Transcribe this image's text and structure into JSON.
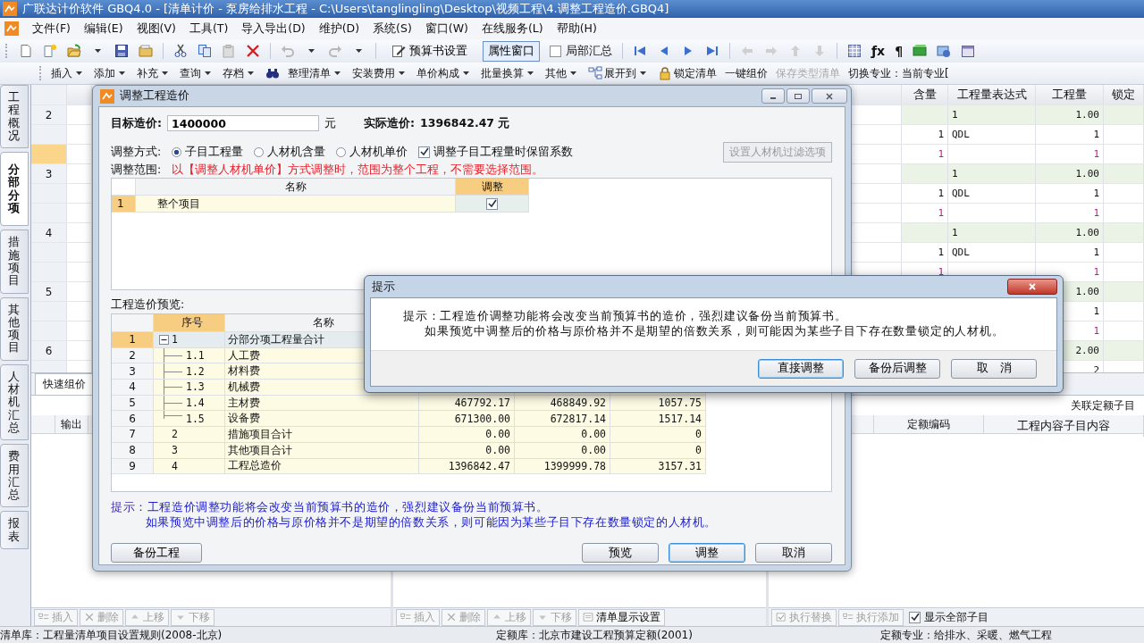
{
  "window": {
    "title": "广联达计价软件 GBQ4.0 - [清单计价 - 泵房给排水工程 - C:\\Users\\tanglingling\\Desktop\\视频工程\\4.调整工程造价.GBQ4]"
  },
  "menu": [
    "文件(F)",
    "编辑(E)",
    "视图(V)",
    "工具(T)",
    "导入导出(D)",
    "维护(D)",
    "系统(S)",
    "窗口(W)",
    "在线服务(L)",
    "帮助(H)"
  ],
  "toolbar": {
    "buttons": [
      {
        "kind": "button",
        "label": "预算书设置",
        "selected": false
      },
      {
        "kind": "button",
        "label": "属性窗口",
        "selected": true
      },
      {
        "kind": "check",
        "label": "局部汇总",
        "checked": false
      }
    ],
    "glyphs": [
      "ƒx",
      "¶"
    ]
  },
  "command_bar": [
    {
      "kind": "text",
      "label": "插入",
      "dropdown": true
    },
    {
      "kind": "text",
      "label": "添加",
      "dropdown": true
    },
    {
      "kind": "text",
      "label": "补充",
      "dropdown": true
    },
    {
      "kind": "text",
      "label": "查询",
      "dropdown": true
    },
    {
      "kind": "text",
      "label": "存档",
      "dropdown": true
    },
    {
      "kind": "search"
    },
    {
      "kind": "text",
      "label": "整理清单",
      "dropdown": true
    },
    {
      "kind": "text",
      "label": "安装费用",
      "dropdown": true
    },
    {
      "kind": "text",
      "label": "单价构成",
      "dropdown": true
    },
    {
      "kind": "text",
      "label": "批量换算",
      "dropdown": true
    },
    {
      "kind": "text",
      "label": "其他",
      "dropdown": true
    },
    {
      "kind": "tree",
      "label": "展开到",
      "dropdown": true
    },
    {
      "kind": "lock",
      "label": "锁定清单",
      "dropdown": false
    },
    {
      "kind": "text",
      "label": "一键组价",
      "dropdown": false
    },
    {
      "kind": "text",
      "label": "保存类型清单",
      "dropdown": false,
      "disabled": true
    },
    {
      "kind": "text",
      "label": "切换专业：当前专业[",
      "dropdown": false
    }
  ],
  "side_tabs": [
    {
      "label": "工程概况",
      "selected": false
    },
    {
      "label": "分部分项",
      "selected": true
    },
    {
      "label": "措施项目",
      "selected": false
    },
    {
      "label": "其他项目",
      "selected": false
    },
    {
      "label": "人材机汇总",
      "selected": false
    },
    {
      "label": "费用汇总",
      "selected": false
    },
    {
      "label": "报表",
      "selected": false
    }
  ],
  "grid": {
    "columns": [
      "含量",
      "工程量表达式",
      "工程量",
      "锁定"
    ],
    "rows": [
      {
        "kind": "list",
        "no": "2",
        "selected": false,
        "cells": [
          "",
          "1",
          "1.00"
        ]
      },
      {
        "kind": "quota",
        "selected": false,
        "cells": [
          "1",
          "QDL",
          "1"
        ]
      },
      {
        "kind": "material",
        "selected": true,
        "cells": [
          "1",
          "",
          "1"
        ]
      },
      {
        "kind": "list",
        "no": "3",
        "selected": false,
        "cells": [
          "",
          "1",
          "1.00"
        ]
      },
      {
        "kind": "quota",
        "selected": false,
        "cells": [
          "1",
          "QDL",
          "1"
        ]
      },
      {
        "kind": "material",
        "selected": false,
        "cells": [
          "1",
          "",
          "1"
        ]
      },
      {
        "kind": "list",
        "no": "4",
        "selected": false,
        "cells": [
          "",
          "1",
          "1.00"
        ]
      },
      {
        "kind": "quota",
        "selected": false,
        "cells": [
          "1",
          "QDL",
          "1"
        ]
      },
      {
        "kind": "material",
        "selected": false,
        "cells": [
          "1",
          "",
          "1"
        ]
      },
      {
        "kind": "list",
        "no": "5",
        "selected": false,
        "cells": [
          "",
          "",
          "1.00"
        ]
      },
      {
        "kind": "quota",
        "selected": false,
        "cells": [
          "",
          "",
          "1"
        ]
      },
      {
        "kind": "material",
        "selected": false,
        "cells": [
          "",
          "",
          "1"
        ]
      },
      {
        "kind": "list",
        "no": "6",
        "selected": false,
        "cells": [
          "",
          "",
          "2.00"
        ]
      },
      {
        "kind": "quota",
        "selected": false,
        "cells": [
          "",
          "",
          "2"
        ]
      }
    ]
  },
  "tabs": [
    {
      "label": "快速组价",
      "selected": true
    }
  ],
  "panels": {
    "left": {
      "columns": [
        "输出"
      ]
    },
    "right": {
      "title": "关联定额子目",
      "columns": [
        "定额编码",
        "工程内容子目内容"
      ]
    }
  },
  "bottom_toolbars": [
    [
      {
        "kind": "insert",
        "label": "插入",
        "disabled": true
      },
      {
        "kind": "delete",
        "label": "删除",
        "disabled": true
      },
      {
        "kind": "up",
        "label": "上移",
        "disabled": true
      },
      {
        "kind": "down",
        "label": "下移",
        "disabled": true
      }
    ],
    [
      {
        "kind": "insert",
        "label": "插入",
        "disabled": true
      },
      {
        "kind": "delete",
        "label": "删除",
        "disabled": true
      },
      {
        "kind": "up",
        "label": "上移",
        "disabled": true
      },
      {
        "kind": "down",
        "label": "下移",
        "disabled": true
      },
      {
        "kind": "list",
        "label": "清单显示设置",
        "disabled": false
      }
    ],
    [
      {
        "kind": "check",
        "label": "执行替换",
        "disabled": true
      },
      {
        "kind": "insert",
        "label": "执行添加",
        "disabled": true
      }
    ]
  ],
  "show_all": {
    "label": "显示全部子目",
    "checked": true
  },
  "status_bar": [
    "清单库：工程量清单项目设置规则(2008-北京)",
    "定额库：北京市建设工程预算定额(2001)",
    "定额专业：给排水、采暖、燃气工程"
  ],
  "dialog": {
    "title": "调整工程造价",
    "target_label": "目标造价:",
    "target_value": "1400000",
    "target_unit": "元",
    "actual_label": "实际造价:",
    "actual_value": "1396842.47 元",
    "mode_label": "调整方式:",
    "modes": [
      {
        "label": "子目工程量",
        "selected": true
      },
      {
        "label": "人材机含量",
        "selected": false
      },
      {
        "label": "人材机单价",
        "selected": false
      }
    ],
    "keep_factor": {
      "label": "调整子目工程量时保留系数",
      "checked": true
    },
    "filter_button": {
      "label": "设置人材机过滤选项",
      "disabled": true
    },
    "range_label": "调整范围:",
    "range_note": "以【调整人材机单价】方式调整时，范围为整个工程，不需要选择范围。",
    "range_table": {
      "columns": [
        "名称",
        "调整"
      ],
      "rows": [
        {
          "row": "1",
          "name": "整个项目",
          "checked": true
        }
      ]
    },
    "preview_label": "工程造价预览:",
    "preview": {
      "columns": [
        "序号",
        "名称"
      ],
      "rows": [
        {
          "row": "1",
          "no": "1",
          "name": "分部分项工程量合计",
          "expanded": true,
          "selected": true,
          "children": [
            {
              "row": "2",
              "no": "1.1",
              "name": "人工费",
              "selected": false
            },
            {
              "row": "3",
              "no": "1.2",
              "name": "材料费",
              "selected": false
            },
            {
              "row": "4",
              "no": "1.3",
              "name": "机械费",
              "selected": false
            },
            {
              "row": "5",
              "no": "1.4",
              "name": "主材费",
              "selected": false,
              "values": [
                "467792.17",
                "468849.92",
                "1057.75"
              ]
            },
            {
              "row": "6",
              "no": "1.5",
              "name": "设备费",
              "selected": false,
              "values": [
                "671300.00",
                "672817.14",
                "1517.14"
              ]
            }
          ]
        },
        {
          "row": "7",
          "no": "2",
          "name": "措施项目合计",
          "selected": false,
          "values": [
            "0.00",
            "0.00",
            "0"
          ]
        },
        {
          "row": "8",
          "no": "3",
          "name": "其他项目合计",
          "selected": false,
          "values": [
            "0.00",
            "0.00",
            "0"
          ]
        },
        {
          "row": "9",
          "no": "4",
          "name": "工程总造价",
          "selected": false,
          "values": [
            "1396842.47",
            "1399999.78",
            "3157.31"
          ]
        }
      ]
    },
    "hint_label": "提示：",
    "hint_lines": [
      "工程造价调整功能将会改变当前预算书的造价，强烈建议备份当前预算书。",
      "如果预览中调整后的价格与原价格并不是期望的倍数关系，则可能因为某些子目下存在数量锁定的人材机。"
    ],
    "buttons": [
      {
        "label": "备份工程",
        "focused": false
      },
      {
        "label": "预览",
        "focused": false
      },
      {
        "label": "调整",
        "focused": true
      },
      {
        "label": "取消",
        "focused": false
      }
    ]
  },
  "prompt": {
    "title": "提示",
    "lines": [
      "提示：工程造价调整功能将会改变当前预算书的造价，强烈建议备份当前预算书。",
      "如果预览中调整后的价格与原价格并不是期望的倍数关系，则可能因为某些子目下存在数量锁定的人材机。"
    ],
    "buttons": [
      {
        "label": "直接调整",
        "focused": true
      },
      {
        "label": "备份后调整",
        "focused": false
      },
      {
        "label": "取　消",
        "focused": false
      }
    ]
  }
}
